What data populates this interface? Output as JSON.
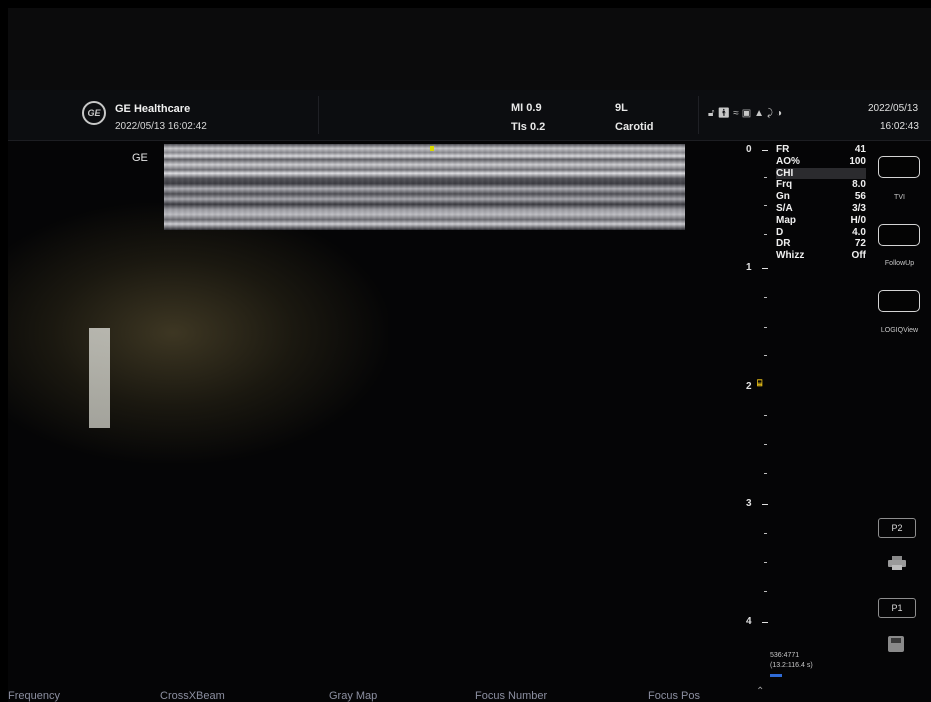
{
  "header": {
    "brand": "GE Healthcare",
    "logo_text": "GE",
    "datetime": "2022/05/13 16:02:42",
    "mi": "MI 0.9",
    "tis": "TIs 0.2",
    "probe": "9L",
    "preset": "Carotid",
    "status_icons": [
      "lock-icon",
      "person-icon",
      "network-icon",
      "disk-icon",
      "warning-icon",
      "plug-icon",
      "contrast-icon"
    ],
    "system_date": "2022/05/13",
    "system_time": "16:02:43"
  },
  "image": {
    "ge_label": "GE"
  },
  "depth_scale": {
    "labels": [
      "0",
      "1",
      "2",
      "3",
      "4"
    ]
  },
  "params": [
    {
      "name": "FR",
      "value": "41"
    },
    {
      "name": "AO%",
      "value": "100"
    },
    {
      "name": "CHI",
      "value": ""
    },
    {
      "name": "Frq",
      "value": "8.0"
    },
    {
      "name": "Gn",
      "value": "56"
    },
    {
      "name": "S/A",
      "value": "3/3"
    },
    {
      "name": "Map",
      "value": "H/0"
    },
    {
      "name": "D",
      "value": "4.0"
    },
    {
      "name": "DR",
      "value": "72"
    },
    {
      "name": "Whizz",
      "value": "Off"
    }
  ],
  "right_panel": {
    "tvi": "TVI",
    "followup": "FollowUp",
    "logiqview": "LOGIQView",
    "p2": "P2",
    "p1": "P1"
  },
  "cine": {
    "frames": "536:4771",
    "time": "(13.2:116.4 s)"
  },
  "bottom_bar": {
    "items": [
      "Frequency",
      "CrossXBeam",
      "Gray Map",
      "Focus Number",
      "Focus Pos"
    ]
  }
}
